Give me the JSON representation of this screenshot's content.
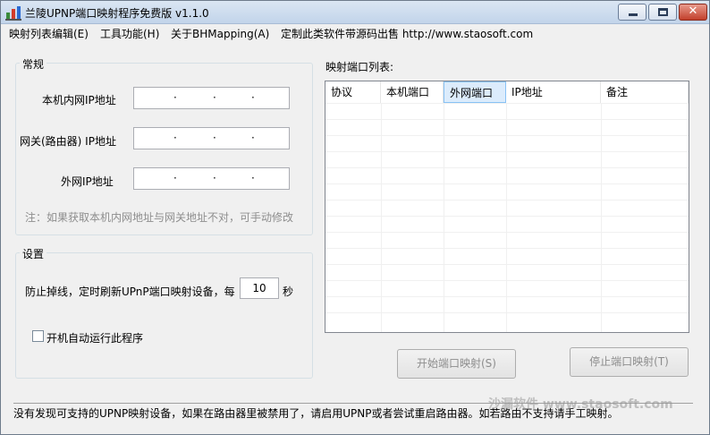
{
  "window": {
    "title": "兰陵UPNP端口映射程序免费版 v1.1.0",
    "close_glyph": "✕"
  },
  "menu": {
    "items": [
      "映射列表编辑(E)",
      "工具功能(H)",
      "关于BHMapping(A)",
      "定制此类软件带源码出售 http://www.staosoft.com"
    ]
  },
  "general": {
    "title": "常规",
    "local_ip_label": "本机内网IP地址",
    "gateway_ip_label": "网关(路由器) IP地址",
    "external_ip_label": "外网IP地址",
    "ip_dot": "·",
    "note": "注：如果获取本机内网地址与网关地址不对，可手动修改"
  },
  "settings": {
    "title": "设置",
    "refresh_prefix": "防止掉线，定时刷新UPnP端口映射设备，每",
    "refresh_value": "10",
    "refresh_suffix": "秒",
    "autostart_label": "开机自动运行此程序",
    "autostart_checked": false
  },
  "mapping": {
    "list_label": "映射端口列表:",
    "columns": [
      "协议",
      "本机端口",
      "外网端口",
      "IP地址",
      "备注"
    ],
    "active_column": "外网端口",
    "rows": []
  },
  "buttons": {
    "start": "开始端口映射(S)",
    "stop": "停止端口映射(T)"
  },
  "status": {
    "text": "没有发现可支持的UPNP映射设备，如果在路由器里被禁用了，请启用UPNP或者尝试重启路由器。如若路由不支持请手工映射。",
    "watermark": "沙漏软件 www.staosoft.com"
  },
  "colors": {
    "titlebar": "#c2d4ea",
    "close_button": "#c2402c",
    "header_highlight": "#dcecfc"
  }
}
